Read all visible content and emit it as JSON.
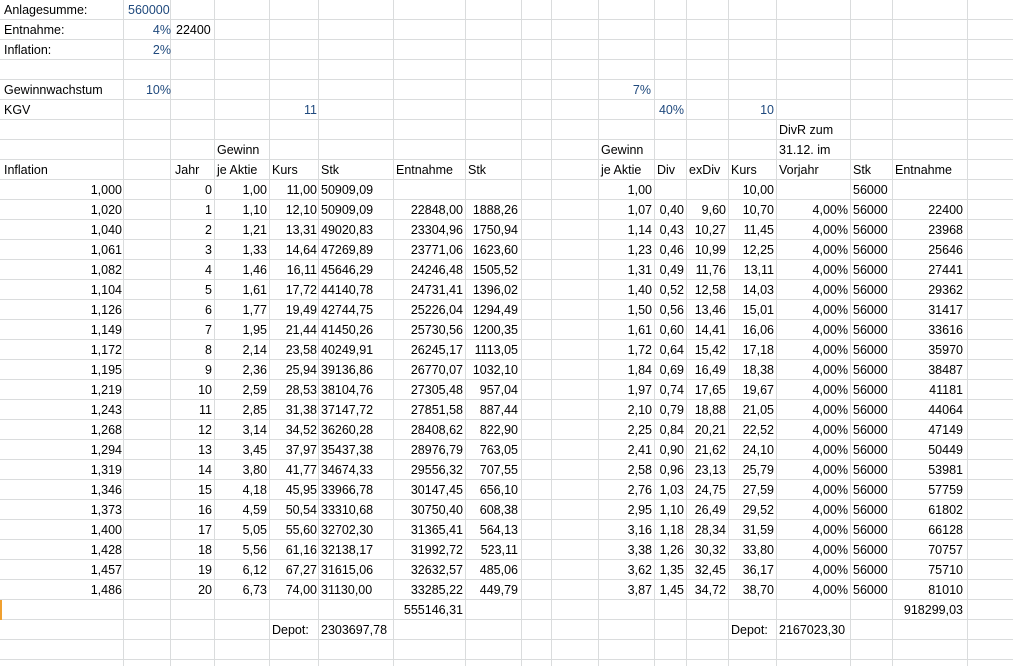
{
  "params": {
    "anlagesumme_label": "Anlagesumme:",
    "anlagesumme_value": "560000",
    "entnahme_label": "Entnahme:",
    "entnahme_pct": "4%",
    "entnahme_value": "22400",
    "inflation_label": "Inflation:",
    "inflation_pct": "2%",
    "gewinnwachstum_label": "Gewinnwachstum",
    "gewinnwachstum_pct": "10%",
    "right_growth_pct": "7%",
    "kgv_label": "KGV",
    "kgv_value": "11",
    "right_payout_pct": "40%",
    "right_kgv_value": "10"
  },
  "headers": {
    "inflation": "Inflation",
    "jahr": "Jahr",
    "gewinn_top": "Gewinn",
    "gewinn_bottom": "je Aktie",
    "kurs": "Kurs",
    "stk": "Stk",
    "entnahme": "Entnahme",
    "stk2": "Stk",
    "r_gewinn_top": "Gewinn",
    "r_gewinn_bottom": "je Aktie",
    "r_div": "Div",
    "r_exdiv": "exDiv",
    "r_kurs": "Kurs",
    "r_divr_1": "DivR zum",
    "r_divr_2": "31.12. im",
    "r_divr_3": "Vorjahr",
    "r_stk": "Stk",
    "r_entnahme": "Entnahme"
  },
  "rows": [
    [
      "1,000",
      "0",
      "1,00",
      "11,00",
      "50909,09",
      "",
      "",
      "1,00",
      "",
      "",
      "10,00",
      "",
      "56000",
      ""
    ],
    [
      "1,020",
      "1",
      "1,10",
      "12,10",
      "50909,09",
      "22848,00",
      "1888,26",
      "1,07",
      "0,40",
      "9,60",
      "10,70",
      "4,00%",
      "56000",
      "22400"
    ],
    [
      "1,040",
      "2",
      "1,21",
      "13,31",
      "49020,83",
      "23304,96",
      "1750,94",
      "1,14",
      "0,43",
      "10,27",
      "11,45",
      "4,00%",
      "56000",
      "23968"
    ],
    [
      "1,061",
      "3",
      "1,33",
      "14,64",
      "47269,89",
      "23771,06",
      "1623,60",
      "1,23",
      "0,46",
      "10,99",
      "12,25",
      "4,00%",
      "56000",
      "25646"
    ],
    [
      "1,082",
      "4",
      "1,46",
      "16,11",
      "45646,29",
      "24246,48",
      "1505,52",
      "1,31",
      "0,49",
      "11,76",
      "13,11",
      "4,00%",
      "56000",
      "27441"
    ],
    [
      "1,104",
      "5",
      "1,61",
      "17,72",
      "44140,78",
      "24731,41",
      "1396,02",
      "1,40",
      "0,52",
      "12,58",
      "14,03",
      "4,00%",
      "56000",
      "29362"
    ],
    [
      "1,126",
      "6",
      "1,77",
      "19,49",
      "42744,75",
      "25226,04",
      "1294,49",
      "1,50",
      "0,56",
      "13,46",
      "15,01",
      "4,00%",
      "56000",
      "31417"
    ],
    [
      "1,149",
      "7",
      "1,95",
      "21,44",
      "41450,26",
      "25730,56",
      "1200,35",
      "1,61",
      "0,60",
      "14,41",
      "16,06",
      "4,00%",
      "56000",
      "33616"
    ],
    [
      "1,172",
      "8",
      "2,14",
      "23,58",
      "40249,91",
      "26245,17",
      "1113,05",
      "1,72",
      "0,64",
      "15,42",
      "17,18",
      "4,00%",
      "56000",
      "35970"
    ],
    [
      "1,195",
      "9",
      "2,36",
      "25,94",
      "39136,86",
      "26770,07",
      "1032,10",
      "1,84",
      "0,69",
      "16,49",
      "18,38",
      "4,00%",
      "56000",
      "38487"
    ],
    [
      "1,219",
      "10",
      "2,59",
      "28,53",
      "38104,76",
      "27305,48",
      "957,04",
      "1,97",
      "0,74",
      "17,65",
      "19,67",
      "4,00%",
      "56000",
      "41181"
    ],
    [
      "1,243",
      "11",
      "2,85",
      "31,38",
      "37147,72",
      "27851,58",
      "887,44",
      "2,10",
      "0,79",
      "18,88",
      "21,05",
      "4,00%",
      "56000",
      "44064"
    ],
    [
      "1,268",
      "12",
      "3,14",
      "34,52",
      "36260,28",
      "28408,62",
      "822,90",
      "2,25",
      "0,84",
      "20,21",
      "22,52",
      "4,00%",
      "56000",
      "47149"
    ],
    [
      "1,294",
      "13",
      "3,45",
      "37,97",
      "35437,38",
      "28976,79",
      "763,05",
      "2,41",
      "0,90",
      "21,62",
      "24,10",
      "4,00%",
      "56000",
      "50449"
    ],
    [
      "1,319",
      "14",
      "3,80",
      "41,77",
      "34674,33",
      "29556,32",
      "707,55",
      "2,58",
      "0,96",
      "23,13",
      "25,79",
      "4,00%",
      "56000",
      "53981"
    ],
    [
      "1,346",
      "15",
      "4,18",
      "45,95",
      "33966,78",
      "30147,45",
      "656,10",
      "2,76",
      "1,03",
      "24,75",
      "27,59",
      "4,00%",
      "56000",
      "57759"
    ],
    [
      "1,373",
      "16",
      "4,59",
      "50,54",
      "33310,68",
      "30750,40",
      "608,38",
      "2,95",
      "1,10",
      "26,49",
      "29,52",
      "4,00%",
      "56000",
      "61802"
    ],
    [
      "1,400",
      "17",
      "5,05",
      "55,60",
      "32702,30",
      "31365,41",
      "564,13",
      "3,16",
      "1,18",
      "28,34",
      "31,59",
      "4,00%",
      "56000",
      "66128"
    ],
    [
      "1,428",
      "18",
      "5,56",
      "61,16",
      "32138,17",
      "31992,72",
      "523,11",
      "3,38",
      "1,26",
      "30,32",
      "33,80",
      "4,00%",
      "56000",
      "70757"
    ],
    [
      "1,457",
      "19",
      "6,12",
      "67,27",
      "31615,06",
      "32632,57",
      "485,06",
      "3,62",
      "1,35",
      "32,45",
      "36,17",
      "4,00%",
      "56000",
      "75710"
    ],
    [
      "1,486",
      "20",
      "6,73",
      "74,00",
      "31130,00",
      "33285,22",
      "449,79",
      "3,87",
      "1,45",
      "34,72",
      "38,70",
      "4,00%",
      "56000",
      "81010"
    ]
  ],
  "totals": {
    "left_entnahme_sum": "555146,31",
    "right_entnahme_sum": "918299,03",
    "depot_label_left": "Depot:",
    "depot_value_left": "2303697,78",
    "depot_label_right": "Depot:",
    "depot_value_right": "2167023,30"
  }
}
